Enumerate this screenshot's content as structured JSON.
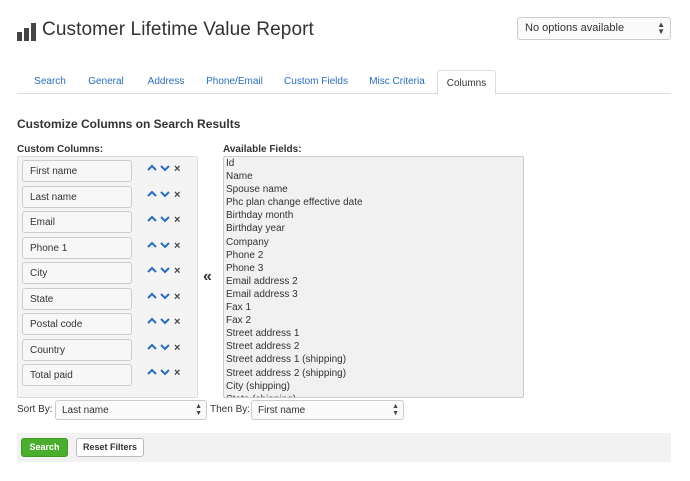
{
  "header": {
    "title": "Customer Lifetime Value Report",
    "report_select_value": "No options available"
  },
  "tabs": [
    {
      "label": "Search",
      "active": false
    },
    {
      "label": "General",
      "active": false
    },
    {
      "label": "Address",
      "active": false
    },
    {
      "label": "Phone/Email",
      "active": false
    },
    {
      "label": "Custom Fields",
      "active": false
    },
    {
      "label": "Misc Criteria",
      "active": false
    },
    {
      "label": "Columns",
      "active": true
    }
  ],
  "main": {
    "section_title": "Customize Columns on Search Results",
    "custom_columns_label": "Custom Columns:",
    "available_fields_label": "Available Fields:",
    "custom_columns": [
      "First name",
      "Last name",
      "Email",
      "Phone 1",
      "City",
      "State",
      "Postal code",
      "Country",
      "Total paid"
    ],
    "available_fields": [
      "Id",
      "Name",
      "Spouse name",
      "Phc plan change effective date",
      "Birthday month",
      "Birthday year",
      "Company",
      "Phone 2",
      "Phone 3",
      "Email address 2",
      "Email address 3",
      "Fax 1",
      "Fax 2",
      "Street address 1",
      "Street address 2",
      "Street address 1 (shipping)",
      "Street address 2 (shipping)",
      "City (shipping)",
      "State (shipping)"
    ],
    "move_left_glyph": "«",
    "up_glyph": "⌃",
    "down_glyph": "⌄",
    "remove_glyph": "×"
  },
  "sort": {
    "sort_by_label": "Sort By:",
    "sort_by_value": "Last name",
    "then_by_label": "Then By:",
    "then_by_value": "First name"
  },
  "footer": {
    "search_label": "Search",
    "reset_label": "Reset Filters"
  },
  "colors": {
    "accent": "#2a6ebb",
    "search_button": "#4cae2f"
  }
}
